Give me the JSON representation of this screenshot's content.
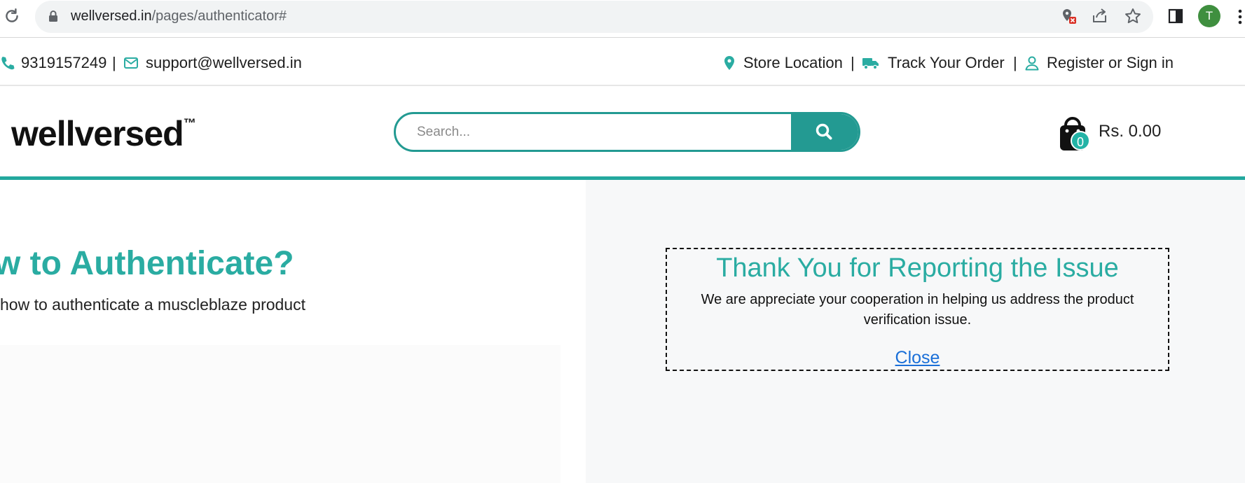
{
  "browser": {
    "url_host": "wellversed.in",
    "url_path": "/pages/authenticator#",
    "profile_initial": "T"
  },
  "topbar": {
    "phone": "9319157249",
    "separator": "|",
    "email": "support@wellversed.in",
    "store_location": "Store Location",
    "track_order": "Track Your Order",
    "register": "Register or Sign in"
  },
  "header": {
    "logo_text": "wellversed",
    "logo_tm": "™",
    "search_placeholder": "Search...",
    "cart_count": "0",
    "cart_total": "Rs. 0.00"
  },
  "main": {
    "heading": "w to Authenticate?",
    "subheading": "how to authenticate a muscleblaze product"
  },
  "dialog": {
    "title": "Thank You for Reporting the Issue",
    "message": "We are appreciate your cooperation in helping us address the product verification issue.",
    "close_label": "Close"
  },
  "colors": {
    "brand_teal": "#2aaca2",
    "search_teal": "#239a92",
    "link_blue": "#1a6fd8"
  }
}
